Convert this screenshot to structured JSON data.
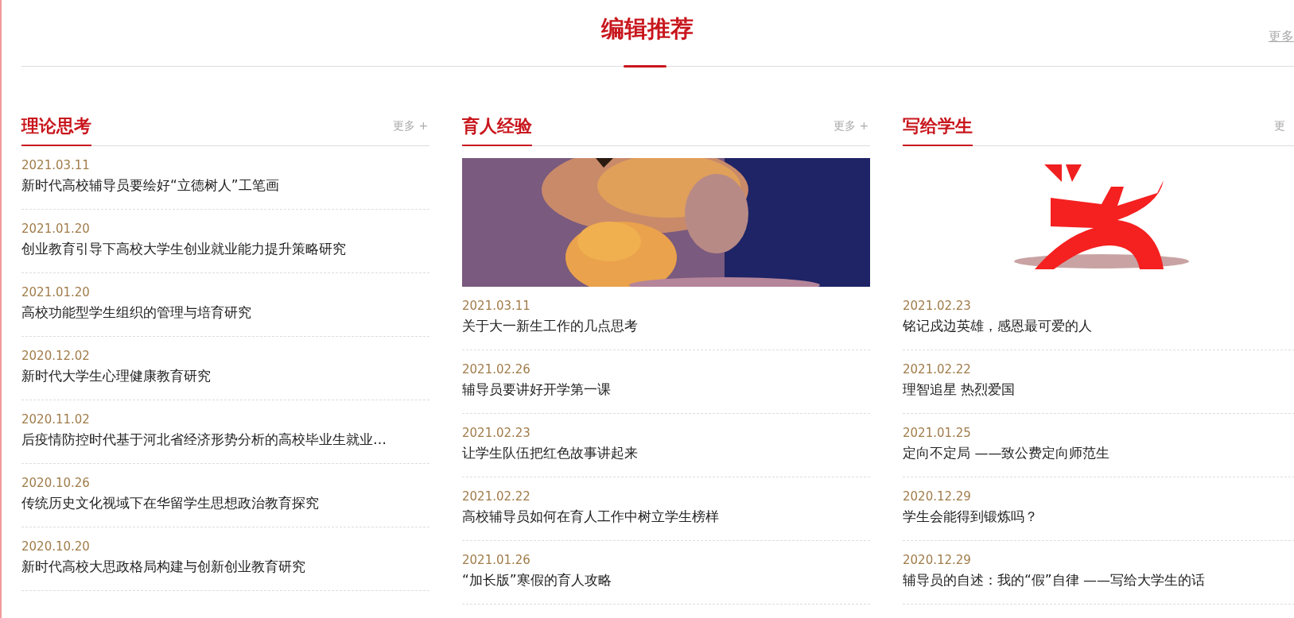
{
  "header": {
    "title": "编辑推荐",
    "more": "更多"
  },
  "columns": [
    {
      "title": "理论思考",
      "more": "更多 +",
      "items": [
        {
          "date": "2021.03.11",
          "title": "新时代高校辅导员要绘好“立德树人”工笔画"
        },
        {
          "date": "2021.01.20",
          "title": "创业教育引导下高校大学生创业就业能力提升策略研究"
        },
        {
          "date": "2021.01.20",
          "title": "高校功能型学生组织的管理与培育研究"
        },
        {
          "date": "2020.12.02",
          "title": "新时代大学生心理健康教育研究"
        },
        {
          "date": "2020.11.02",
          "title": "后疫情防控时代基于河北省经济形势分析的高校毕业生就业…"
        },
        {
          "date": "2020.10.26",
          "title": "传统历史文化视域下在华留学生思想政治教育探究"
        },
        {
          "date": "2020.10.20",
          "title": "新时代高校大思政格局构建与创新创业教育研究"
        }
      ]
    },
    {
      "title": "育人经验",
      "more": "更多 +",
      "items": [
        {
          "date": "2021.03.11",
          "title": "关于大一新生工作的几点思考"
        },
        {
          "date": "2021.02.26",
          "title": "辅导员要讲好开学第一课"
        },
        {
          "date": "2021.02.23",
          "title": "让学生队伍把红色故事讲起来"
        },
        {
          "date": "2021.02.22",
          "title": "高校辅导员如何在育人工作中树立学生榜样"
        },
        {
          "date": "2021.01.26",
          "title": "“加长版”寒假的育人攻略"
        }
      ]
    },
    {
      "title": "写给学生",
      "more": "更",
      "media": {
        "kind": "logo"
      },
      "items": [
        {
          "date": "2021.02.23",
          "title": "铭记戍边英雄，感恩最可爱的人"
        },
        {
          "date": "2021.02.22",
          "title": "理智追星 热烈爱国"
        },
        {
          "date": "2021.01.25",
          "title": "定向不定局 ——致公费定向师范生"
        },
        {
          "date": "2020.12.29",
          "title": "学生会能得到锻炼吗？"
        },
        {
          "date": "2020.12.29",
          "title": "辅导员的自述：我的“假”自律 ——写给大学生的话"
        }
      ]
    }
  ]
}
